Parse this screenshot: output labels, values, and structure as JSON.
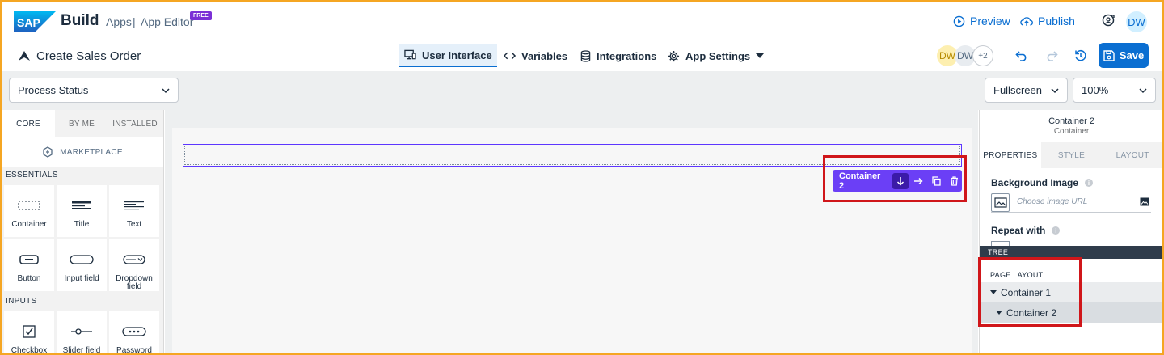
{
  "header": {
    "brand": "SAP",
    "product": "Build",
    "apps": "Apps",
    "separator": "|",
    "editor": "App Editor",
    "free_badge": "FREE",
    "preview": "Preview",
    "publish": "Publish",
    "avatar": "DW"
  },
  "subheader": {
    "page_title": "Create Sales Order",
    "tabs": [
      {
        "label": "User Interface",
        "icon": "monitor-icon",
        "active": true
      },
      {
        "label": "Variables",
        "icon": "code-icon",
        "active": false
      },
      {
        "label": "Integrations",
        "icon": "database-icon",
        "active": false
      },
      {
        "label": "App Settings",
        "icon": "gear-icon",
        "active": false
      }
    ],
    "collaborators": [
      "DW",
      "DW",
      "+2"
    ],
    "save": "Save"
  },
  "toolbar": {
    "page_select": "Process Status",
    "view_select": "Fullscreen",
    "zoom_select": "100%"
  },
  "left_panel": {
    "tabs": [
      "CORE",
      "BY ME",
      "INSTALLED"
    ],
    "active_tab": "CORE",
    "marketplace": "MARKETPLACE",
    "sections": [
      {
        "title": "ESSENTIALS",
        "items": [
          "Container",
          "Title",
          "Text",
          "Button",
          "Input field",
          "Dropdown field"
        ]
      },
      {
        "title": "INPUTS",
        "items": [
          "Checkbox field",
          "Slider field",
          "Password field"
        ]
      }
    ]
  },
  "canvas": {
    "selected_label": "Container 2"
  },
  "right_panel": {
    "title": "Container 2",
    "subtitle": "Container",
    "tabs": [
      "PROPERTIES",
      "STYLE",
      "LAYOUT"
    ],
    "active_tab": "PROPERTIES",
    "background_image_label": "Background Image",
    "image_placeholder": "Choose image URL",
    "repeat_with_label": "Repeat with",
    "tree_header": "TREE",
    "page_layout": "PAGE LAYOUT",
    "tree_nodes": [
      "Container 1",
      "Container 2"
    ]
  },
  "colors": {
    "accent": "#0a6ed1",
    "selection": "#6b3ff6",
    "highlight": "#d0161a"
  }
}
